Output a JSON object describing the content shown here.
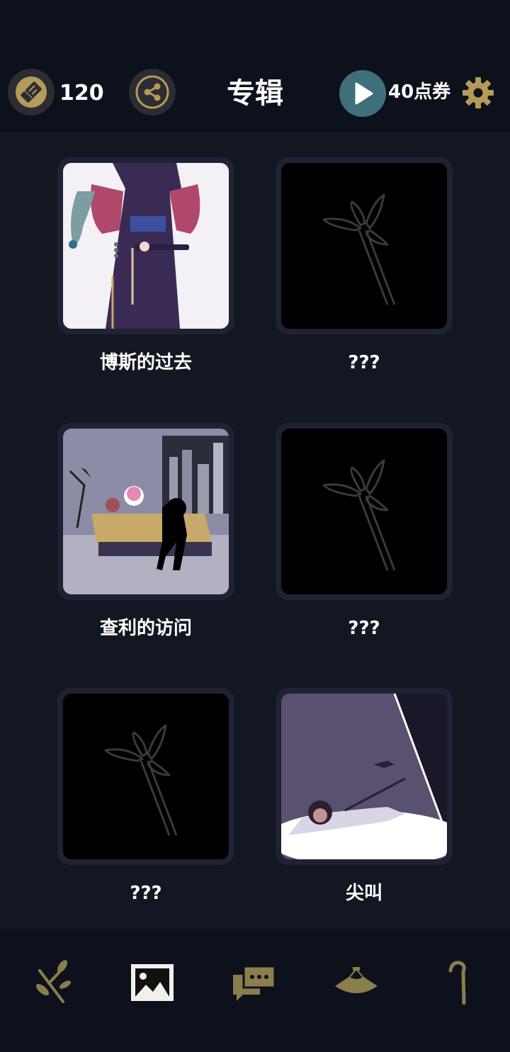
{
  "header": {
    "ticket_count": "120",
    "title": "专辑",
    "points": "40点券"
  },
  "albums": [
    {
      "caption": "博斯的过去",
      "unlocked": true
    },
    {
      "caption": "???",
      "unlocked": false
    },
    {
      "caption": "查利的访问",
      "unlocked": true
    },
    {
      "caption": "???",
      "unlocked": false
    },
    {
      "caption": "???",
      "unlocked": false
    },
    {
      "caption": "尖叫",
      "unlocked": true
    }
  ],
  "nav": [
    {
      "icon": "branch-icon",
      "active": false
    },
    {
      "icon": "album-icon",
      "active": true
    },
    {
      "icon": "chat-icon",
      "active": false
    },
    {
      "icon": "hat-icon",
      "active": false
    },
    {
      "icon": "cane-icon",
      "active": false
    }
  ],
  "colors": {
    "gold": "#b49b5a",
    "background": "#131721",
    "bar": "#0d111b",
    "card_frame": "#1e2233",
    "play": "#3f6f7a"
  }
}
